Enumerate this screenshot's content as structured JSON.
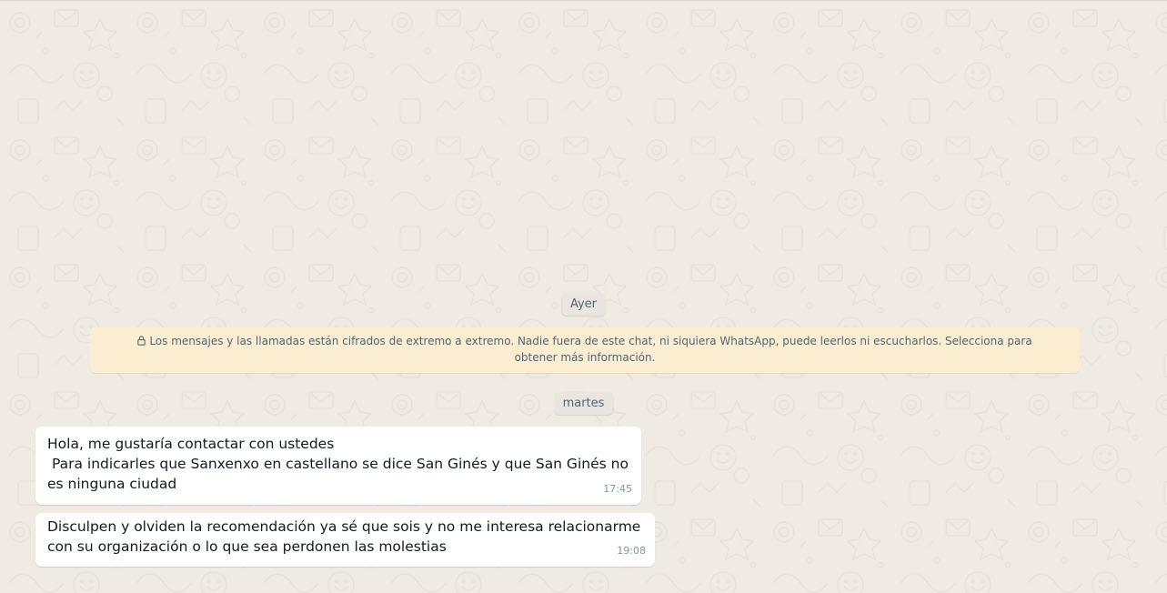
{
  "conversation": {
    "date_separators": {
      "yesterday": "Ayer",
      "tuesday": "martes"
    },
    "encryption_notice": {
      "icon": "lock-icon",
      "text": "Los mensajes y las llamadas están cifrados de extremo a extremo. Nadie fuera de este chat, ni siquiera WhatsApp, puede leerlos ni escucharlos. Selecciona para obtener más información.",
      "background_color": "#fbedd0"
    },
    "messages": [
      {
        "direction": "incoming",
        "text": "Hola, me gustaría contactar con ustedes\n Para indicarles que Sanxenxo en castellano se dice San Ginés y que San Ginés no es ninguna ciudad",
        "time": "17:45"
      },
      {
        "direction": "incoming",
        "text": "Disculpen y olviden la recomendación ya sé que sois y no me interesa relacionarme con su organización o lo que sea perdonen las molestias",
        "time": "19:08"
      }
    ]
  },
  "theme": {
    "chat_background": "#efeae2",
    "incoming_bubble": "#ffffff",
    "meta_text": "#8696a0"
  }
}
